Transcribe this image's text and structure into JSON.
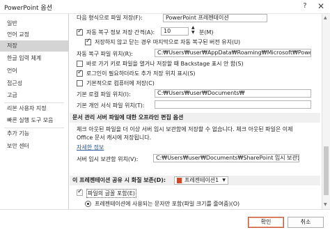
{
  "window": {
    "title": "PowerPoint 옵션",
    "help_glyph": "?",
    "close_glyph": "✕"
  },
  "sidebar": {
    "items": [
      {
        "label": "일반"
      },
      {
        "label": "언어 교정"
      },
      {
        "label": "저장",
        "selected": true
      },
      {
        "label": "한글 입력 체계"
      },
      {
        "label": "언어"
      },
      {
        "label": "접근성"
      },
      {
        "label": "고급"
      },
      {
        "label": "리본 사용자 지정"
      },
      {
        "label": "빠른 실행 도구 모음"
      },
      {
        "label": "추가 기능"
      },
      {
        "label": "보안 센터"
      }
    ]
  },
  "save": {
    "format_label": "다음 형식으로 파일 저장(F):",
    "format_value": "PowerPoint 프레젠테이션",
    "autorecover_label": "자동 복구 정보 저장 간격(A):",
    "autorecover_checked": true,
    "autorecover_minutes": "10",
    "autorecover_unit": "분(M)",
    "keep_last_label": "저장하지 않고 닫는 경우 마지막으로 자동 복구된 버전 유지(U)",
    "keep_last_checked": true,
    "autorecover_path_label": "자동 복구 파일 위치(R):",
    "autorecover_path": "C:₩Users₩user₩AppData₩Roaming₩Microsoft₩PowerPoint₩",
    "no_backstage_label": "바로 가기 키로 파일을 열거나 저장할 때 Backstage 표시 안 함(S)",
    "no_backstage_checked": false,
    "show_additional_label": "로그인이 필요하더라도 추가 저장 위치 표시(S)",
    "show_additional_checked": true,
    "default_computer_label": "기본적으로 컴퓨터에 저장(C)",
    "default_computer_checked": false,
    "default_local_label": "기본 로컬 파일 위치(I):",
    "default_local_path": "C:₩Users₩user₩Documents₩",
    "personal_template_label": "기본 개인 서식 파일 위치(T):",
    "personal_template_path": ""
  },
  "offline": {
    "section_title": "문서 관리 서버 파일에 대한 오프라인 편집 옵션",
    "desc_line1": "체크 아웃된 파일을 더 이상 서버 임시 보관함에 저장할 수 없습니다. 체크 아웃된 파일은 이제",
    "desc_line2": "Office 문서 캐시에 저장됩니다.",
    "learn_more": "자세한 정보",
    "drafts_label": "서버 임시 보관함 위치(V):",
    "drafts_path": "C:₩Users₩user₩Documents₩SharePoint 임시 보관함₩"
  },
  "fidelity": {
    "section_title": "이 프레젠테이션 공유 시 화질 보존(D):",
    "presentation_value": "프레젠테이션1",
    "embed_label": "파일의 글꼴 포함(E)",
    "embed_checked": true,
    "only_used_label": "프레젠테이션에 사용되는 문자만 포함(파일 크기를 줄여줌)(O)"
  },
  "footer": {
    "ok_label": "확인",
    "cancel_label": "취소"
  }
}
